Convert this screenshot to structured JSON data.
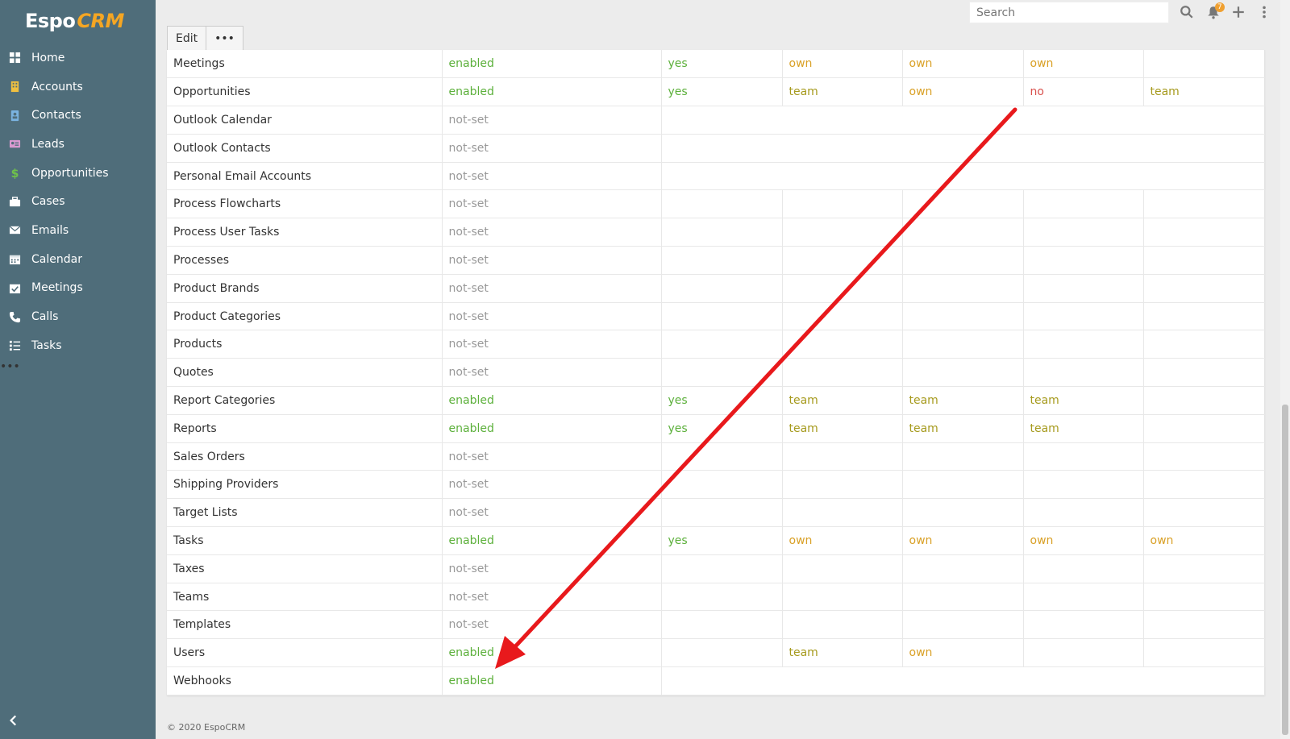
{
  "brand": {
    "logo_main": "Espo",
    "logo_accent": "CRM"
  },
  "sidebar": {
    "items": [
      {
        "label": "Home",
        "icon": "home-icon"
      },
      {
        "label": "Accounts",
        "icon": "building-icon"
      },
      {
        "label": "Contacts",
        "icon": "address-book-icon"
      },
      {
        "label": "Leads",
        "icon": "id-card-icon"
      },
      {
        "label": "Opportunities",
        "icon": "dollar-icon"
      },
      {
        "label": "Cases",
        "icon": "briefcase-icon"
      },
      {
        "label": "Emails",
        "icon": "envelope-icon"
      },
      {
        "label": "Calendar",
        "icon": "calendar-icon"
      },
      {
        "label": "Meetings",
        "icon": "calendar-check-icon"
      },
      {
        "label": "Calls",
        "icon": "phone-icon"
      },
      {
        "label": "Tasks",
        "icon": "tasks-icon"
      }
    ],
    "more_label": "•••"
  },
  "header": {
    "search_placeholder": "Search",
    "notification_count": "7"
  },
  "toolbar": {
    "edit_label": "Edit",
    "more_label": "•••"
  },
  "table": {
    "rows": [
      {
        "name": "Meetings",
        "access": "enabled",
        "cells": [
          "yes",
          "own",
          "own",
          "own",
          ""
        ]
      },
      {
        "name": "Opportunities",
        "access": "enabled",
        "cells": [
          "yes",
          "team",
          "own",
          "no",
          "team"
        ]
      },
      {
        "name": "Outlook Calendar",
        "access": "not-set",
        "span": true
      },
      {
        "name": "Outlook Contacts",
        "access": "not-set",
        "span": true
      },
      {
        "name": "Personal Email Accounts",
        "access": "not-set",
        "span": true
      },
      {
        "name": "Process Flowcharts",
        "access": "not-set",
        "cells": [
          "",
          "",
          "",
          "",
          ""
        ]
      },
      {
        "name": "Process User Tasks",
        "access": "not-set",
        "cells": [
          "",
          "",
          "",
          "",
          ""
        ]
      },
      {
        "name": "Processes",
        "access": "not-set",
        "cells": [
          "",
          "",
          "",
          "",
          ""
        ]
      },
      {
        "name": "Product Brands",
        "access": "not-set",
        "cells": [
          "",
          "",
          "",
          "",
          ""
        ]
      },
      {
        "name": "Product Categories",
        "access": "not-set",
        "cells": [
          "",
          "",
          "",
          "",
          ""
        ]
      },
      {
        "name": "Products",
        "access": "not-set",
        "cells": [
          "",
          "",
          "",
          "",
          ""
        ]
      },
      {
        "name": "Quotes",
        "access": "not-set",
        "cells": [
          "",
          "",
          "",
          "",
          ""
        ]
      },
      {
        "name": "Report Categories",
        "access": "enabled",
        "cells": [
          "yes",
          "team",
          "team",
          "team",
          ""
        ]
      },
      {
        "name": "Reports",
        "access": "enabled",
        "cells": [
          "yes",
          "team",
          "team",
          "team",
          ""
        ]
      },
      {
        "name": "Sales Orders",
        "access": "not-set",
        "cells": [
          "",
          "",
          "",
          "",
          ""
        ]
      },
      {
        "name": "Shipping Providers",
        "access": "not-set",
        "cells": [
          "",
          "",
          "",
          "",
          ""
        ]
      },
      {
        "name": "Target Lists",
        "access": "not-set",
        "cells": [
          "",
          "",
          "",
          "",
          ""
        ]
      },
      {
        "name": "Tasks",
        "access": "enabled",
        "cells": [
          "yes",
          "own",
          "own",
          "own",
          "own"
        ]
      },
      {
        "name": "Taxes",
        "access": "not-set",
        "cells": [
          "",
          "",
          "",
          "",
          ""
        ]
      },
      {
        "name": "Teams",
        "access": "not-set",
        "cells": [
          "",
          "",
          "",
          "",
          ""
        ]
      },
      {
        "name": "Templates",
        "access": "not-set",
        "cells": [
          "",
          "",
          "",
          "",
          ""
        ]
      },
      {
        "name": "Users",
        "access": "enabled",
        "cells": [
          "",
          "team",
          "own",
          "",
          ""
        ]
      },
      {
        "name": "Webhooks",
        "access": "enabled",
        "span": true
      }
    ]
  },
  "footer": {
    "copyright": "© 2020 EspoCRM"
  },
  "colors": {
    "sidebar_bg": "#4f6d7a",
    "enabled": "#5cb03b",
    "team": "#a69a1d",
    "own": "#d9a026",
    "no": "#d9534f",
    "annotation_arrow": "#e8191c"
  }
}
